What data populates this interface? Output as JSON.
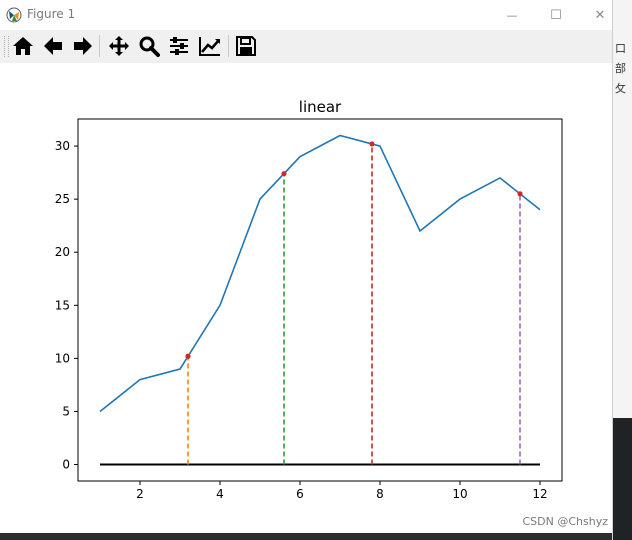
{
  "window": {
    "title": "Figure 1",
    "minimize_glyph": "—",
    "maximize_glyph": "☐",
    "close_glyph": "✕"
  },
  "toolbar": {
    "tools": [
      "home-icon",
      "back-arrow-icon",
      "forward-arrow-icon",
      "pan-icon",
      "zoom-icon",
      "configure-subplots-icon",
      "edit-axis-icon",
      "save-icon"
    ]
  },
  "side_glyphs": [
    "口",
    "部",
    "攵"
  ],
  "watermark": "CSDN @Chshyz",
  "colors": {
    "line": "#1f77b4",
    "baseline": "#000000",
    "points": "#d62728"
  },
  "chart_data": {
    "type": "line",
    "title": "linear",
    "x": [
      1,
      2,
      3,
      4,
      5,
      6,
      7,
      8,
      9,
      10,
      11,
      12
    ],
    "series": [
      {
        "values": [
          5,
          8,
          9,
          15,
          25,
          29,
          31,
          30,
          22,
          25,
          27,
          24
        ]
      }
    ],
    "baseline": {
      "y": 0,
      "x_range": [
        1,
        12
      ]
    },
    "markers": [
      {
        "x": 3.2,
        "y": 10.2,
        "color": "#ff7f0e"
      },
      {
        "x": 5.6,
        "y": 27.4,
        "color": "#2ca02c"
      },
      {
        "x": 7.8,
        "y": 30.2,
        "color": "#d62728"
      },
      {
        "x": 11.5,
        "y": 25.5,
        "color": "#9467bd"
      }
    ],
    "xlim": [
      0.45,
      12.55
    ],
    "ylim": [
      -1.55,
      32.55
    ],
    "xticks": [
      2,
      4,
      6,
      8,
      10,
      12
    ],
    "yticks": [
      0,
      5,
      10,
      15,
      20,
      25,
      30
    ],
    "grid": false
  }
}
